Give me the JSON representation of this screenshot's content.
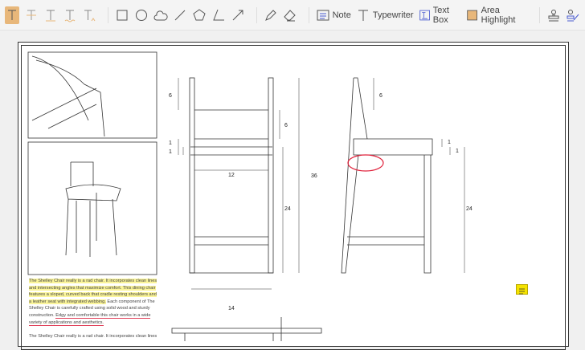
{
  "toolbar": {
    "note": "Note",
    "typewriter": "Typewriter",
    "textbox": "Text Box",
    "area_highlight": "Area Highlight"
  },
  "dims": {
    "front_top": "6",
    "front_back": "6",
    "front_seat1": "1",
    "front_seat2": "1",
    "front_width": "12",
    "overall_height": "36",
    "front_leg": "24",
    "base_width": "14",
    "side_top": "6",
    "side_seat1": "1",
    "side_seat2": "1",
    "side_leg": "24"
  },
  "text": {
    "p1_highlight": "The Shelley Chair really is a rad chair. It incorporates clean lines and intersecting angles that maximize comfort. This dining chair features a sloped, curved back that cradle resting shoulders and a leather seat with integrated webbing.",
    "p1_plain": " Each component of The Shelley Chair is carefully crafted using solid wood and sturdy construction. ",
    "p1_underline": "Edgy and comfortable this chair works in a wide variety of applications and aesthetics.",
    "p2": "The Shelley Chair really is a rad chair. It incorporates clean lines"
  },
  "colors": {
    "highlight": "#fbf59a",
    "underline": "#e0405a",
    "active_tool": "#e8b77a",
    "note": "#f5e300"
  }
}
